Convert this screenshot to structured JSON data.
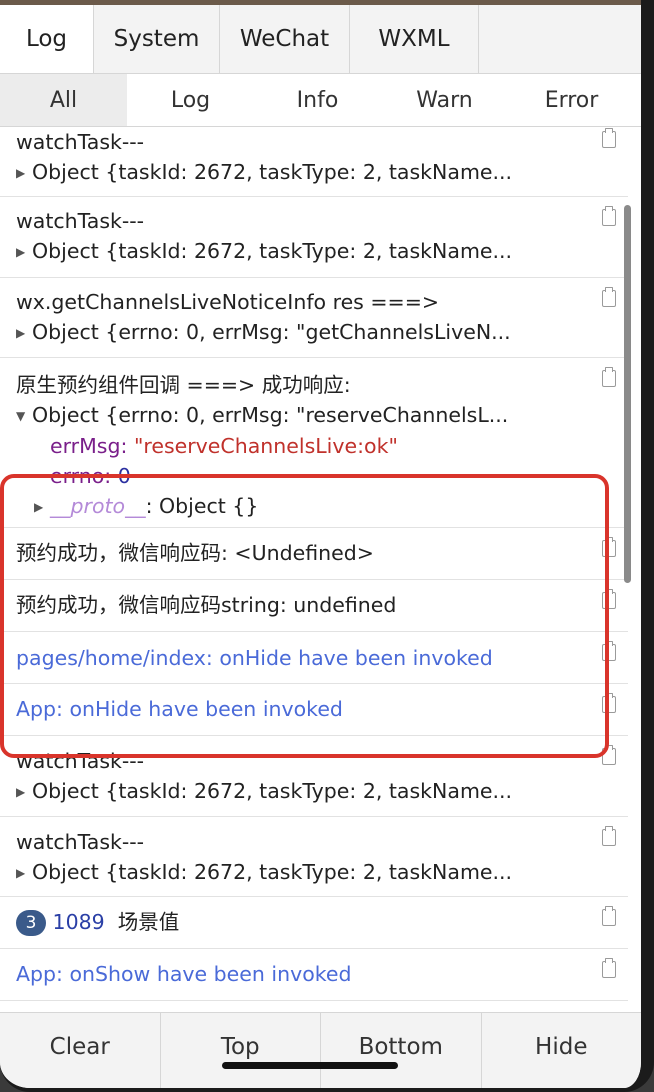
{
  "main_tabs": [
    {
      "label": "Log",
      "active": true
    },
    {
      "label": "System",
      "active": false
    },
    {
      "label": "WeChat",
      "active": false
    },
    {
      "label": "WXML",
      "active": false
    }
  ],
  "sub_tabs": [
    {
      "label": "All",
      "active": true
    },
    {
      "label": "Log",
      "active": false
    },
    {
      "label": "Info",
      "active": false
    },
    {
      "label": "Warn",
      "active": false
    },
    {
      "label": "Error",
      "active": false
    }
  ],
  "entries": {
    "e1": {
      "title": "watchTask---",
      "object": "Object {taskId: 2672, taskType: 2, taskName..."
    },
    "e2": {
      "title": "watchTask---",
      "object": "Object {taskId: 2672, taskType: 2, taskName..."
    },
    "e3": {
      "title": "wx.getChannelsLiveNoticeInfo res ===>",
      "object": "Object {errno: 0, errMsg: \"getChannelsLiveN..."
    },
    "e4": {
      "title": "原生预约组件回调 ===>  成功响应:",
      "object": "Object {errno: 0, errMsg: \"reserveChannelsL...",
      "errmsg_key": "errMsg",
      "errmsg_val": "\"reserveChannelsLive:ok\"",
      "errno_key": "errno",
      "errno_val": "0",
      "proto_key": "__proto__",
      "proto_val": ": Object {}"
    },
    "e5": {
      "text": "预约成功，微信响应码: <Undefined>"
    },
    "e6": {
      "text": "预约成功，微信响应码string: undefined"
    },
    "e7": {
      "text": "pages/home/index: onHide have been invoked"
    },
    "e8": {
      "text": "App: onHide have been invoked"
    },
    "e9": {
      "title": "watchTask---",
      "object": "Object {taskId: 2672, taskType: 2, taskName..."
    },
    "e10": {
      "title": "watchTask---",
      "object": "Object {taskId: 2672, taskType: 2, taskName..."
    },
    "e11": {
      "badge": "3",
      "number": "1089",
      "label": "场景值"
    },
    "e12": {
      "text": "App: onShow have been invoked"
    }
  },
  "bottom_bar": {
    "clear": "Clear",
    "top": "Top",
    "bottom": "Bottom",
    "hide": "Hide"
  },
  "colors": {
    "highlight": "#d9342b",
    "info_text": "#4a6ad8",
    "string": "#c0312b",
    "key": "#7a1f8a",
    "badge": "#3a5a8a"
  }
}
